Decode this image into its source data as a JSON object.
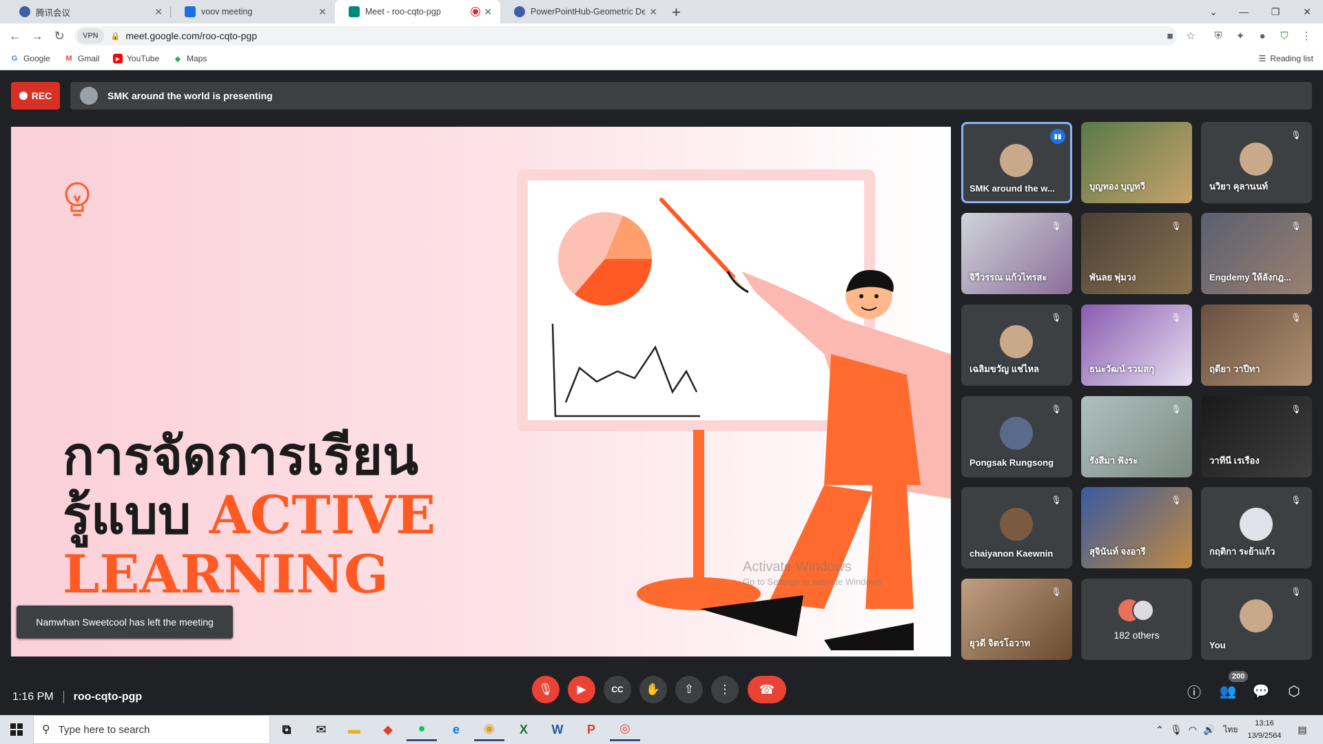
{
  "browser": {
    "tabs": [
      {
        "label": "腾讯会议",
        "favicon_color": "#3c5fa8"
      },
      {
        "label": "voov meeting",
        "favicon_color": "#1b6fe3"
      },
      {
        "label": "Meet - roo-cqto-pgp",
        "favicon_color": "#00897b",
        "active": true
      },
      {
        "label": "PowerPointHub-Geometric Desig",
        "favicon_color": "#3c5fa8"
      }
    ],
    "url": "meet.google.com/roo-cqto-pgp",
    "vpn_label": "VPN",
    "bookmarks": [
      {
        "label": "Google",
        "icon": "google-icon"
      },
      {
        "label": "Gmail",
        "icon": "gmail-icon"
      },
      {
        "label": "YouTube",
        "icon": "youtube-icon"
      },
      {
        "label": "Maps",
        "icon": "maps-icon"
      }
    ],
    "reading_list": "Reading list"
  },
  "meet": {
    "rec_label": "REC",
    "presenting_banner": "SMK around the world is presenting",
    "slide": {
      "line1": "การจัดการเรียน",
      "line2a": "รู้แบบ ",
      "line2b": "ACTIVE",
      "line3": "LEARNING",
      "watermark1": "Activate Windows",
      "watermark2": "Go to Settings to activate Windows."
    },
    "toast": "Namwhan Sweetcool has left the meeting",
    "participants": [
      {
        "name": "SMK around the w...",
        "speaking": true,
        "video": false
      },
      {
        "name": "บุญทอง บุญทวี",
        "video": true
      },
      {
        "name": "นวิยา คุลานนท์",
        "muted": true,
        "video": false
      },
      {
        "name": "จิวีวรรณ แก้วไทรสะ",
        "muted": true,
        "video": true
      },
      {
        "name": "พันลย พุ่มวง",
        "muted": true,
        "video": true
      },
      {
        "name": "Engdemy ให้ลังกฎ...",
        "muted": true,
        "video": true
      },
      {
        "name": "เฉลิมขวัญ แช่ไหล",
        "muted": true,
        "video": false
      },
      {
        "name": "ธนะวัฒน์ รวมสกุ",
        "muted": true,
        "video": true
      },
      {
        "name": "ฤดียา วาปีทา",
        "muted": true,
        "video": true
      },
      {
        "name": "Pongsak Rungsong",
        "muted": true,
        "video": false
      },
      {
        "name": "รังสีมา ฟังระ",
        "muted": true,
        "video": true
      },
      {
        "name": "วาทีนี เรเรือง",
        "muted": true,
        "video": true
      },
      {
        "name": "chaiyanon Kaewnin",
        "muted": true,
        "video": false
      },
      {
        "name": "สุจินันท์ จงอารี",
        "muted": true,
        "video": true
      },
      {
        "name": "กฤติกา ระย้าแก้ว",
        "muted": true,
        "video": false
      },
      {
        "name": "ยุวดี จิตรโอวาท",
        "muted": true,
        "video": true
      },
      {
        "name": "182 others",
        "others": true
      },
      {
        "name": "You",
        "muted": true,
        "video": false
      }
    ],
    "time": "1:16 PM",
    "meeting_code": "roo-cqto-pgp",
    "people_count": "200"
  },
  "taskbar": {
    "search_placeholder": "Type here to search",
    "language": "ไทย",
    "clock_time": "13:16",
    "clock_date": "13/9/2564"
  },
  "colors": {
    "accent_orange": "#ff5a24",
    "meet_red": "#ea4335",
    "meet_bg": "#202124",
    "tile_bg": "#3c4043",
    "highlight": "#8ab4f8"
  }
}
